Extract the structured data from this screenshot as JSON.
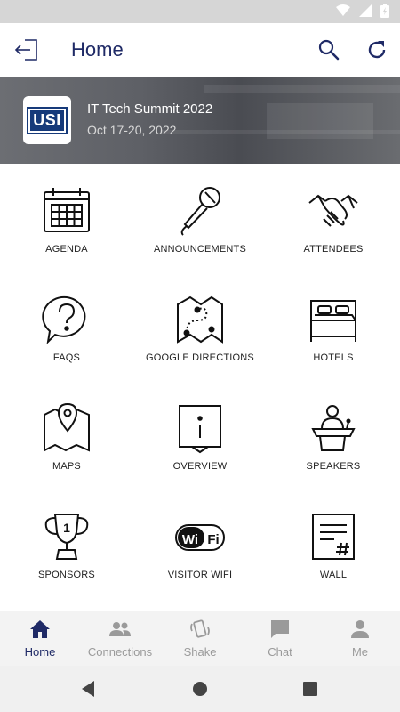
{
  "header": {
    "title": "Home"
  },
  "event": {
    "logo_text": "USI",
    "title": "IT Tech Summit 2022",
    "dates": "Oct 17-20, 2022"
  },
  "tiles": [
    {
      "label": "AGENDA",
      "icon": "calendar-icon"
    },
    {
      "label": "ANNOUNCEMENTS",
      "icon": "microphone-icon"
    },
    {
      "label": "ATTENDEES",
      "icon": "handshake-icon"
    },
    {
      "label": "FAQS",
      "icon": "question-bubble-icon"
    },
    {
      "label": "GOOGLE DIRECTIONS",
      "icon": "route-map-icon"
    },
    {
      "label": "HOTELS",
      "icon": "bed-icon"
    },
    {
      "label": "MAPS",
      "icon": "map-pin-icon"
    },
    {
      "label": "OVERVIEW",
      "icon": "info-board-icon"
    },
    {
      "label": "SPEAKERS",
      "icon": "podium-speaker-icon"
    },
    {
      "label": "SPONSORS",
      "icon": "trophy-icon"
    },
    {
      "label": "VISITOR WIFI",
      "icon": "wifi-icon"
    },
    {
      "label": "WALL",
      "icon": "wall-post-icon"
    }
  ],
  "bottom_nav": [
    {
      "label": "Home",
      "icon": "home-icon",
      "active": true
    },
    {
      "label": "Connections",
      "icon": "people-icon",
      "active": false
    },
    {
      "label": "Shake",
      "icon": "shake-phone-icon",
      "active": false
    },
    {
      "label": "Chat",
      "icon": "chat-icon",
      "active": false
    },
    {
      "label": "Me",
      "icon": "person-icon",
      "active": false
    }
  ],
  "colors": {
    "brand": "#1f2a66",
    "inactive": "#9a9a9a",
    "status_bar": "#d6d6d6"
  }
}
